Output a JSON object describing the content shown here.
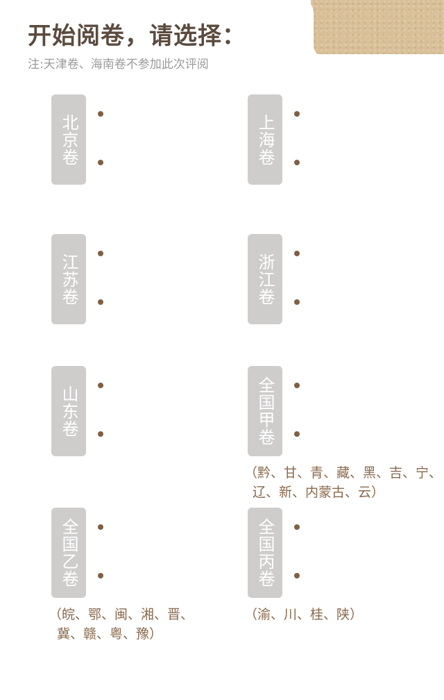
{
  "header": {
    "title": "开始阅卷，请选择：",
    "subtitle": "注:天津卷、海南卷不参加此次评阅"
  },
  "exams": [
    {
      "label": "北京卷",
      "note": ""
    },
    {
      "label": "上海卷",
      "note": ""
    },
    {
      "label": "江苏卷",
      "note": ""
    },
    {
      "label": "浙江卷",
      "note": ""
    },
    {
      "label": "山东卷",
      "note": ""
    },
    {
      "label": "全国甲卷",
      "note_line1": "（黔、甘、青、藏、黑、吉、宁、",
      "note_line2": "辽、新、内蒙古、云）"
    },
    {
      "label": "全国乙卷",
      "note_line1": "（皖、鄂、闽、湘、晋、",
      "note_line2": "冀、赣、粤、豫）"
    },
    {
      "label": "全国丙卷",
      "note_line1": "（渝、川、桂、陕）"
    }
  ],
  "colors": {
    "title": "#5b4b3f",
    "subtitle": "#9a9a9a",
    "tab": "#cecdcc",
    "dot": "#7f6045",
    "note": "#8a6a4d",
    "paper": "#d8bf98"
  }
}
